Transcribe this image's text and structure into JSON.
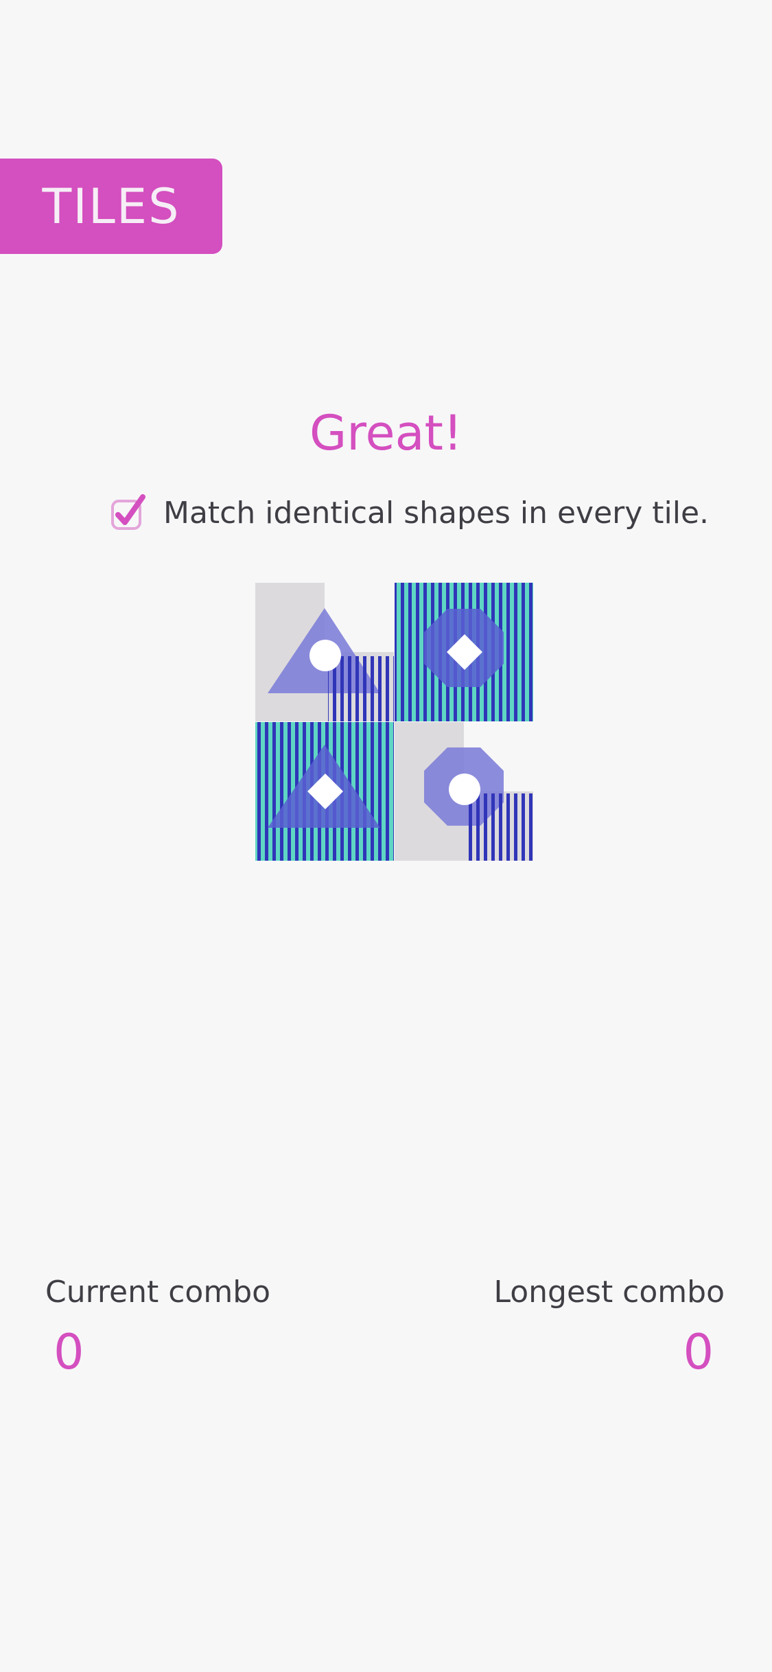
{
  "app": {
    "brand_label": "TILES",
    "accent_color": "#d44fbf"
  },
  "game": {
    "status_text": "Great!",
    "instruction": {
      "text": "Match identical shapes in every tile.",
      "checked": true,
      "icon": "checkbox-checked-icon"
    },
    "board": {
      "rows": 2,
      "cols": 2,
      "tiles": [
        {
          "background": "gray",
          "layers": [
            {
              "shape": "triangle",
              "color": "#7f80d9"
            },
            {
              "shape": "circle",
              "color": "#ffffff"
            },
            {
              "shape": "stripes-small",
              "color": "#3035b8"
            }
          ]
        },
        {
          "background": "striped-teal",
          "layers": [
            {
              "shape": "stripes-full",
              "color": "#3035b8"
            },
            {
              "shape": "octagon",
              "color": "#5b5fd1"
            },
            {
              "shape": "diamond",
              "color": "#ffffff"
            }
          ]
        },
        {
          "background": "striped-teal",
          "layers": [
            {
              "shape": "stripes-full",
              "color": "#3035b8"
            },
            {
              "shape": "triangle",
              "color": "#5b5fd1"
            },
            {
              "shape": "diamond",
              "color": "#ffffff"
            }
          ]
        },
        {
          "background": "gray",
          "layers": [
            {
              "shape": "octagon",
              "color": "#7f80d9"
            },
            {
              "shape": "circle",
              "color": "#ffffff"
            },
            {
              "shape": "stripes-small",
              "color": "#3035b8"
            }
          ]
        }
      ]
    }
  },
  "stats": {
    "current_label": "Current combo",
    "current_value": "0",
    "longest_label": "Longest combo",
    "longest_value": "0"
  }
}
